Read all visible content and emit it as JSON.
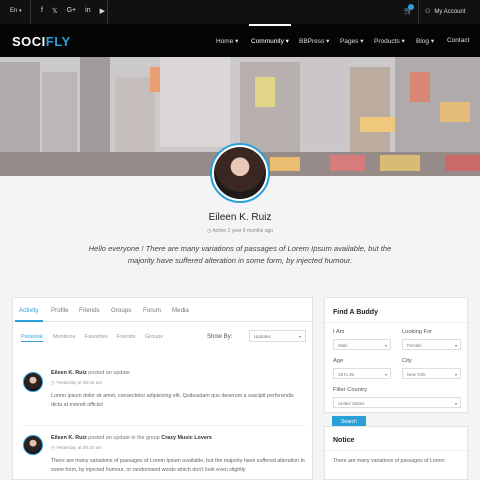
{
  "topbar": {
    "language": "En",
    "social": [
      "f",
      "𝕏",
      "G+",
      "in",
      "▶"
    ],
    "cart_count": "",
    "account_label": "My Account"
  },
  "brand": {
    "logo_part1": "SOCI",
    "logo_part2": "FLY"
  },
  "nav": {
    "items": [
      {
        "label": "Home ▾"
      },
      {
        "label": "Community ▾"
      },
      {
        "label": "BBPress ▾"
      },
      {
        "label": "Pages ▾"
      },
      {
        "label": "Products ▾"
      },
      {
        "label": "Blog ▾"
      },
      {
        "label": "Contact"
      }
    ]
  },
  "profile": {
    "name": "Eileen K. Ruiz",
    "active_status": "Active 1 year 9 months ago",
    "bio": "Hello everyone ! There are many variations of passages of Lorem Ipsum available, but the majority have suffered alteration in some form, by injected humour."
  },
  "tabs": [
    "Activity",
    "Profile",
    "Friends",
    "Groups",
    "Forum",
    "Media"
  ],
  "subtabs": [
    "Personal",
    "Mentions",
    "Favorites",
    "Friends",
    "Groups"
  ],
  "show_by": {
    "label": "Show By:",
    "value": "Updates"
  },
  "posts": [
    {
      "author": "Eileen K. Ruiz",
      "action": "posted an update",
      "group": "",
      "time": "Yesterday at 08:25 am",
      "body": "Lorem ipsum dolor sit amet, consectetur adipisicing elit. Quibusdam quo deserunt a suscipit perferendis dicta at everett officiis!"
    },
    {
      "author": "Eileen K. Ruiz",
      "action": "posted an update in the group",
      "group": "Crazy Music Lovers",
      "time": "Yesterday at 08:20 am",
      "body": "There are many variations of passages of Lorem Ipsum available, but the majority have suffered alteration in some form, by injected humour, or randomised words which don't look even slightly"
    }
  ],
  "find_buddy": {
    "title": "Find A Buddy",
    "i_am_label": "I Am",
    "i_am_value": "Male",
    "looking_for_label": "Looking For",
    "looking_for_value": "Female",
    "age_label": "Age",
    "age_value": "18 to 25",
    "city_label": "City",
    "city_value": "New York",
    "country_label": "Filter Country",
    "country_value": "United States",
    "search_label": "Search"
  },
  "notice": {
    "title": "Notice",
    "text": "There are many variations of passages of Lorem"
  },
  "colors": {
    "accent": "#2a9fd8",
    "nav_bg": "#050505",
    "topbar_bg": "#111111"
  }
}
